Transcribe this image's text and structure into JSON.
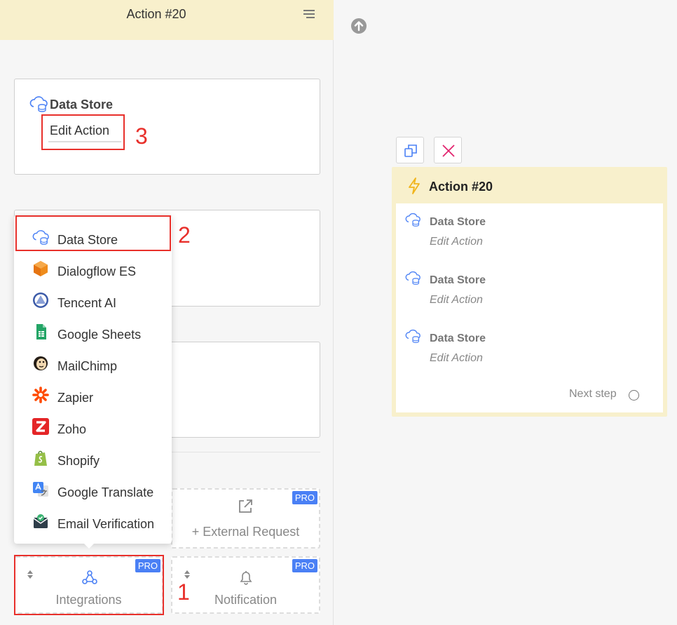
{
  "panel": {
    "title": "Action #20"
  },
  "main_card": {
    "title": "Data Store",
    "edit_label": "Edit Action"
  },
  "dropdown": {
    "items": [
      {
        "label": "Data Store",
        "icon": "data-store-icon"
      },
      {
        "label": "Dialogflow ES",
        "icon": "dialogflow-icon"
      },
      {
        "label": "Tencent AI",
        "icon": "tencent-icon"
      },
      {
        "label": "Google Sheets",
        "icon": "google-sheets-icon"
      },
      {
        "label": "MailChimp",
        "icon": "mailchimp-icon"
      },
      {
        "label": "Zapier",
        "icon": "zapier-icon"
      },
      {
        "label": "Zoho",
        "icon": "zoho-icon"
      },
      {
        "label": "Shopify",
        "icon": "shopify-icon"
      },
      {
        "label": "Google Translate",
        "icon": "google-translate-icon"
      },
      {
        "label": "Email Verification",
        "icon": "email-verification-icon"
      }
    ]
  },
  "tiles": {
    "external": {
      "label": "+ External Request",
      "badge": "PRO"
    },
    "integrations": {
      "label": "Integrations",
      "badge": "PRO"
    },
    "notification": {
      "label": "Notification",
      "badge": "PRO"
    }
  },
  "annotations": {
    "one": "1",
    "two": "2",
    "three": "3"
  },
  "node": {
    "title": "Action #20",
    "steps": [
      {
        "title": "Data Store",
        "sub": "Edit Action"
      },
      {
        "title": "Data Store",
        "sub": "Edit Action"
      },
      {
        "title": "Data Store",
        "sub": "Edit Action"
      }
    ],
    "next_step": "Next step"
  },
  "colors": {
    "header_bg": "#f8f0cc",
    "pro_badge": "#4a80f5",
    "annotation_red": "#e8302b",
    "icon_blue": "#4a80f5"
  }
}
